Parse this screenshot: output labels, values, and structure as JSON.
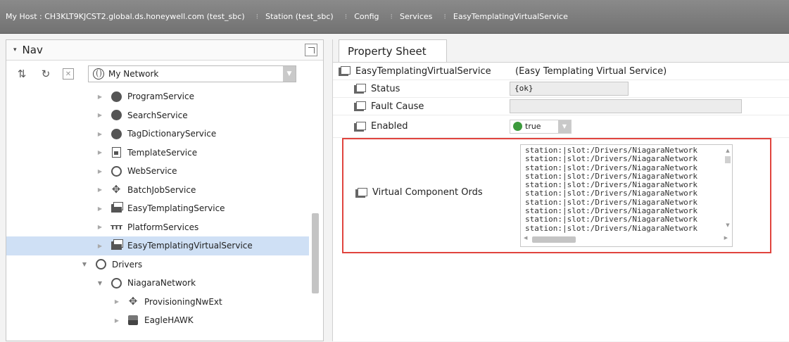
{
  "breadcrumb": [
    {
      "label": "My Host : CH3KLT9KJCST2.global.ds.honeywell.com (test_sbc)"
    },
    {
      "label": "Station (test_sbc)"
    },
    {
      "label": "Config"
    },
    {
      "label": "Services"
    },
    {
      "label": "EasyTemplatingVirtualService"
    }
  ],
  "nav": {
    "title": "Nav",
    "network_select": "My Network",
    "tree": [
      {
        "label": "ProgramService",
        "icon": "program-icon",
        "state": "collapsed"
      },
      {
        "label": "SearchService",
        "icon": "search-icon",
        "state": "collapsed"
      },
      {
        "label": "TagDictionaryService",
        "icon": "tag-icon",
        "state": "collapsed"
      },
      {
        "label": "TemplateService",
        "icon": "template-icon",
        "state": "collapsed"
      },
      {
        "label": "WebService",
        "icon": "globe-icon",
        "state": "collapsed"
      },
      {
        "label": "BatchJobService",
        "icon": "diamond-icon",
        "state": "collapsed"
      },
      {
        "label": "EasyTemplatingService",
        "icon": "folder-icon",
        "state": "collapsed"
      },
      {
        "label": "PlatformServices",
        "icon": "rail-icon",
        "state": "collapsed"
      },
      {
        "label": "EasyTemplatingVirtualService",
        "icon": "folder-icon",
        "state": "collapsed",
        "selected": true
      },
      {
        "label": "Drivers",
        "icon": "ring-icon",
        "state": "expanded"
      },
      {
        "label": "NiagaraNetwork",
        "icon": "ring-icon",
        "state": "expanded"
      },
      {
        "label": "ProvisioningNwExt",
        "icon": "diamond-icon",
        "state": "collapsed"
      },
      {
        "label": "EagleHAWK",
        "icon": "eagle-icon",
        "state": "collapsed"
      }
    ]
  },
  "property_sheet": {
    "tab": "Property Sheet",
    "root_name": "EasyTemplatingVirtualService",
    "root_desc": "(Easy Templating Virtual Service)",
    "status_label": "Status",
    "status_value": "{ok}",
    "fault_label": "Fault Cause",
    "fault_value": "",
    "enabled_label": "Enabled",
    "enabled_value": "true",
    "ords_label": "Virtual Component Ords",
    "ords": [
      "station:|slot:/Drivers/NiagaraNetwork",
      "station:|slot:/Drivers/NiagaraNetwork",
      "station:|slot:/Drivers/NiagaraNetwork",
      "station:|slot:/Drivers/NiagaraNetwork",
      "station:|slot:/Drivers/NiagaraNetwork",
      "station:|slot:/Drivers/NiagaraNetwork",
      "station:|slot:/Drivers/NiagaraNetwork",
      "station:|slot:/Drivers/NiagaraNetwork",
      "station:|slot:/Drivers/NiagaraNetwork",
      "station:|slot:/Drivers/NiagaraNetwork"
    ],
    "enabled_color": "#3c9a3c",
    "highlight_color": "#e0443e"
  }
}
